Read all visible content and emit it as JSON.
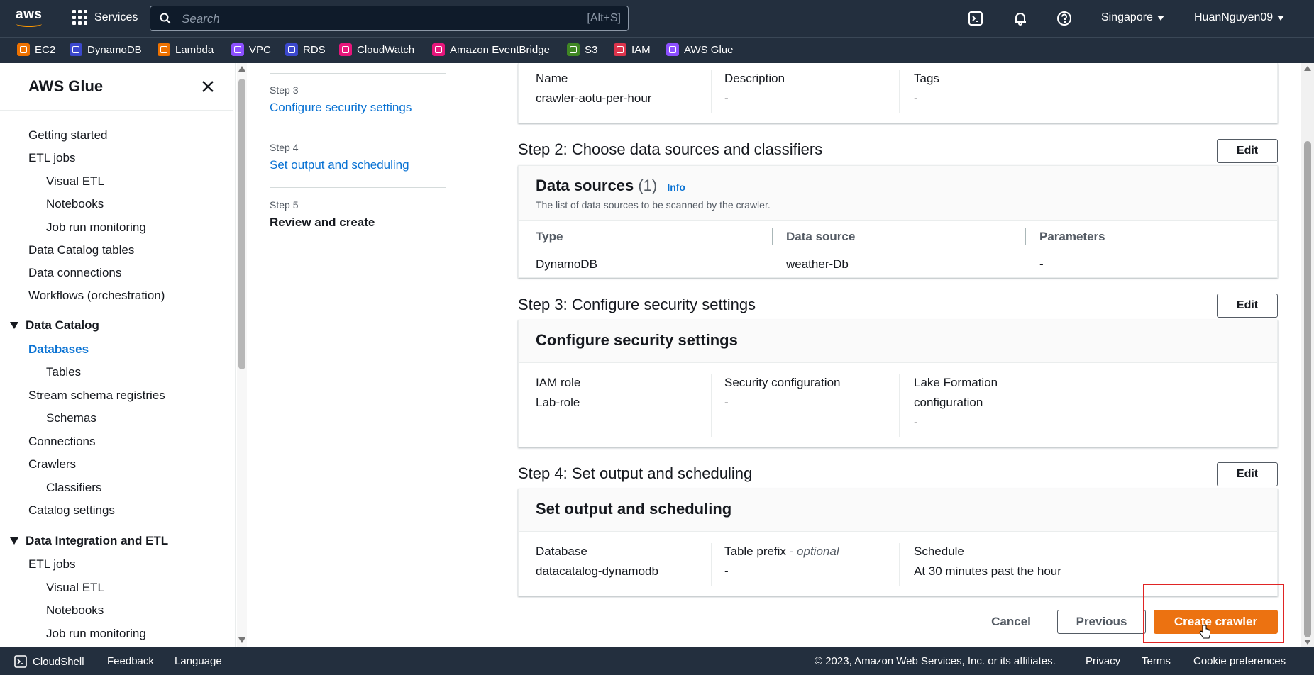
{
  "topnav": {
    "logo_text": "aws",
    "services_label": "Services",
    "search_placeholder": "Search",
    "search_shortcut": "[Alt+S]",
    "region": "Singapore",
    "account": "HuanNguyen09"
  },
  "favorites": [
    {
      "label": "EC2",
      "color": "#ed7100"
    },
    {
      "label": "DynamoDB",
      "color": "#3b48cc"
    },
    {
      "label": "Lambda",
      "color": "#ed7100"
    },
    {
      "label": "VPC",
      "color": "#8c4fff"
    },
    {
      "label": "RDS",
      "color": "#3b48cc"
    },
    {
      "label": "CloudWatch",
      "color": "#e7157b"
    },
    {
      "label": "Amazon EventBridge",
      "color": "#e7157b"
    },
    {
      "label": "S3",
      "color": "#3f8624"
    },
    {
      "label": "IAM",
      "color": "#dd344c"
    },
    {
      "label": "AWS Glue",
      "color": "#8c4fff"
    }
  ],
  "sidebar": {
    "title": "AWS Glue",
    "links": [
      "Getting started",
      "ETL jobs",
      "Visual ETL",
      "Notebooks",
      "Job run monitoring",
      "Data Catalog tables",
      "Data connections",
      "Workflows (orchestration)"
    ],
    "section_data_catalog": "Data Catalog",
    "data_catalog_links": [
      "Databases",
      "Tables",
      "Stream schema registries",
      "Schemas",
      "Connections",
      "Crawlers",
      "Classifiers",
      "Catalog settings"
    ],
    "section_data_integration": "Data Integration and ETL",
    "integration_links": [
      "ETL jobs",
      "Visual ETL",
      "Notebooks",
      "Job run monitoring"
    ]
  },
  "steps": [
    {
      "num": "Step 3",
      "name": "Configure security settings"
    },
    {
      "num": "Step 4",
      "name": "Set output and scheduling"
    },
    {
      "num": "Step 5",
      "name": "Review and create"
    }
  ],
  "step1_card": {
    "name_label": "Name",
    "name_value": "crawler-aotu-per-hour",
    "description_label": "Description",
    "description_value": "-",
    "tags_label": "Tags",
    "tags_value": "-"
  },
  "step2": {
    "heading": "Step 2: Choose data sources and classifiers",
    "edit_label": "Edit",
    "card_title": "Data sources",
    "count": "(1)",
    "info": "Info",
    "description": "The list of data sources to be scanned by the crawler.",
    "columns": [
      "Type",
      "Data source",
      "Parameters"
    ],
    "rows": [
      [
        "DynamoDB",
        "weather-Db",
        "-"
      ]
    ]
  },
  "step3": {
    "heading": "Step 3: Configure security settings",
    "edit_label": "Edit",
    "card_title": "Configure security settings",
    "iam_label": "IAM role",
    "iam_value": "Lab-role",
    "secconf_label": "Security configuration",
    "secconf_value": "-",
    "lakeform_label_1": "Lake Formation",
    "lakeform_label_2": "configuration",
    "lakeform_value": "-"
  },
  "step4": {
    "heading": "Step 4: Set output and scheduling",
    "edit_label": "Edit",
    "card_title": "Set output and scheduling",
    "db_label": "Database",
    "db_value": "datacatalog-dynamodb",
    "prefix_label": "Table prefix",
    "prefix_optional": " - optional",
    "prefix_value": "-",
    "schedule_label": "Schedule",
    "schedule_value": "At 30 minutes past the hour"
  },
  "actions": {
    "cancel": "Cancel",
    "previous": "Previous",
    "create": "Create crawler"
  },
  "footer": {
    "cloudshell": "CloudShell",
    "feedback": "Feedback",
    "language": "Language",
    "copyright": "© 2023, Amazon Web Services, Inc. or its affiliates.",
    "privacy": "Privacy",
    "terms": "Terms",
    "cookie": "Cookie preferences"
  }
}
